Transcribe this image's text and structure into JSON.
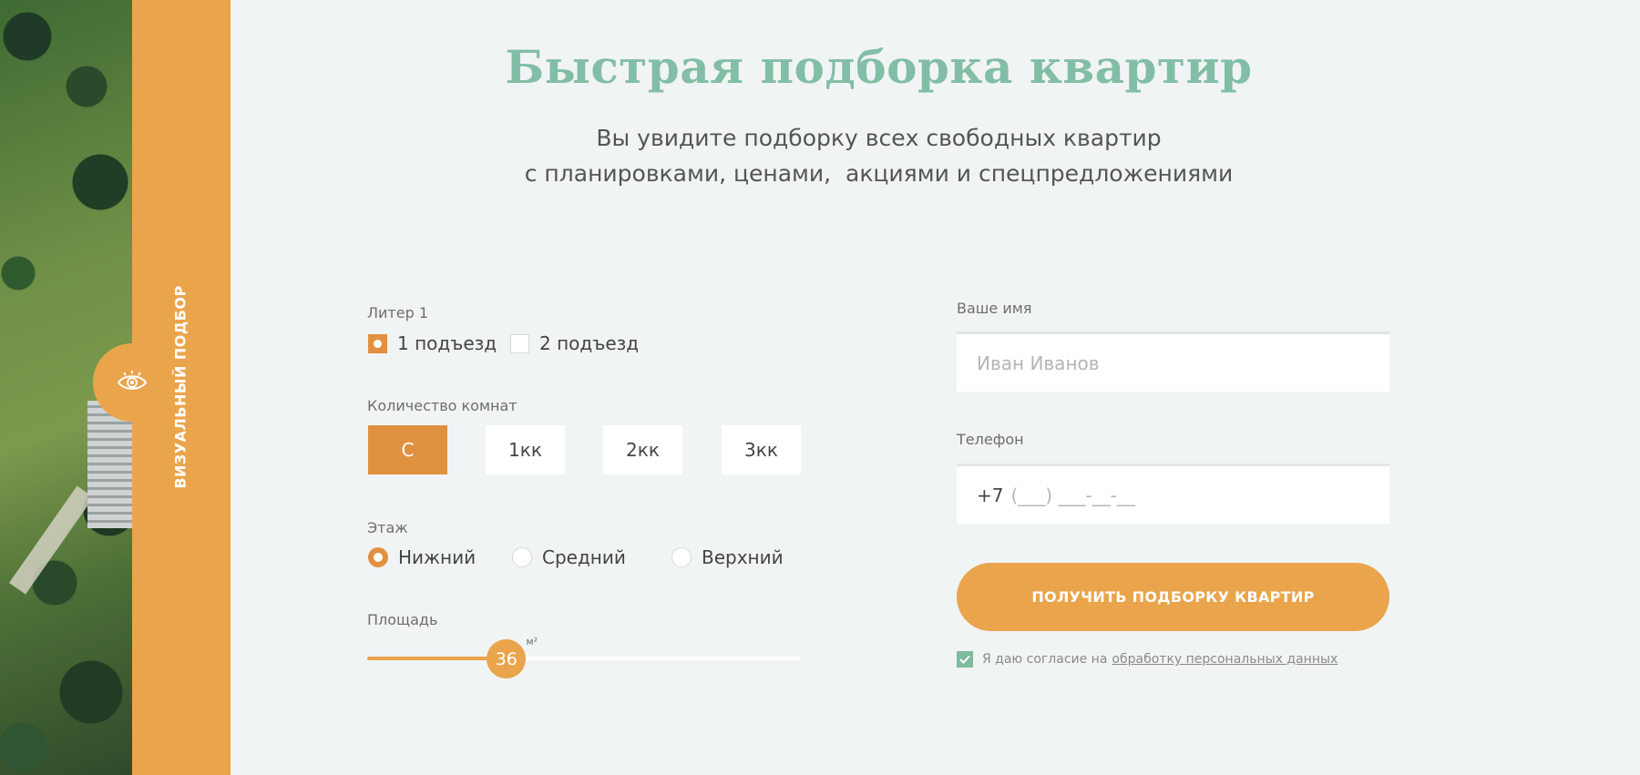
{
  "side": {
    "label": "ВИЗУАЛЬНЫЙ ПОДБОР",
    "icon": "eye-icon"
  },
  "header": {
    "title": "Быстрая подборка квартир",
    "subtitle_line1": "Вы увидите подборку всех свободных квартир",
    "subtitle_line2": "с планировками, ценами,  акциями и спецпредложениями"
  },
  "filters": {
    "liter_label": "Литер 1",
    "entrances": [
      {
        "label": "1 подъезд",
        "checked": true
      },
      {
        "label": "2 подъезд",
        "checked": false
      }
    ],
    "rooms_label": "Количество комнат",
    "rooms": [
      {
        "label": "С",
        "active": true
      },
      {
        "label": "1кк",
        "active": false
      },
      {
        "label": "2кк",
        "active": false
      },
      {
        "label": "3кк",
        "active": false
      }
    ],
    "floor_label": "Этаж",
    "floors": [
      {
        "label": "Нижний",
        "checked": true
      },
      {
        "label": "Средний",
        "checked": false
      },
      {
        "label": "Верхний",
        "checked": false
      }
    ],
    "area_label": "Площадь",
    "area_value": "36",
    "area_unit": "м²",
    "area_fraction": 0.32
  },
  "form": {
    "name_label": "Ваше имя",
    "name_placeholder": "Иван Иванов",
    "phone_label": "Телефон",
    "phone_prefix": "+7",
    "phone_placeholder": "(___) ___-__-__",
    "submit_label": "ПОЛУЧИТЬ ПОДБОРКУ КВАРТИР",
    "consent_text": "Я даю согласие на",
    "consent_link": "обработку персональных данных",
    "consent_checked": true
  },
  "colors": {
    "accent": "#eaa54c",
    "accent_dark": "#e0913f",
    "title_green": "#82bea5",
    "background": "#f1f4f4"
  }
}
